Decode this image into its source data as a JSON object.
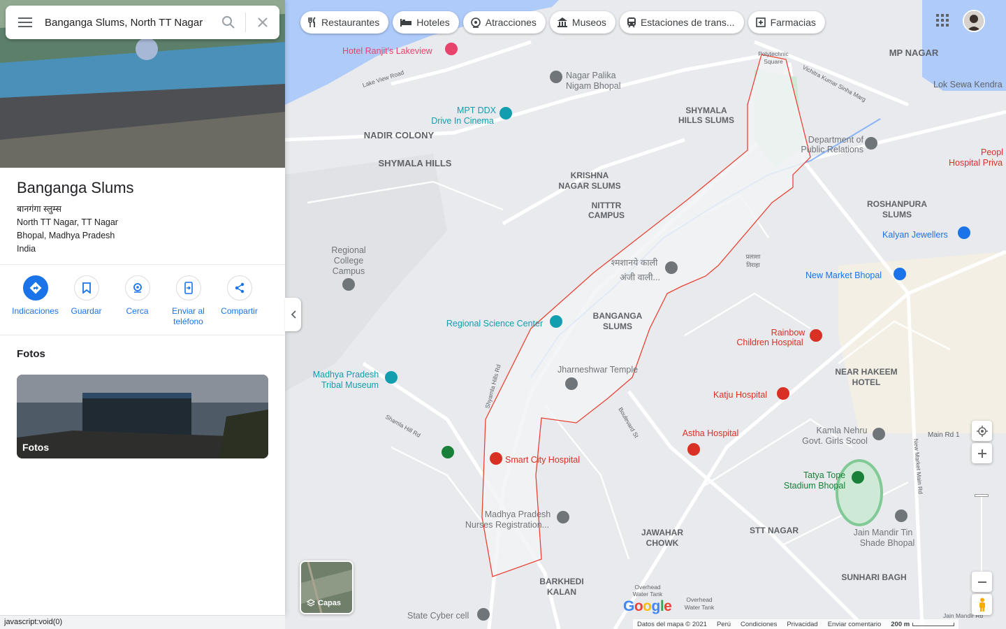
{
  "search": {
    "query": "Banganga Slums, North TT Nagar"
  },
  "place": {
    "name": "Banganga Slums",
    "name_local": "बानगंगा स्लुम्स",
    "address_lines": [
      "North TT Nagar, TT Nagar",
      "Bhopal, Madhya Pradesh",
      "India"
    ]
  },
  "actions": [
    {
      "label": "Indicaciones",
      "icon": "directions-icon"
    },
    {
      "label": "Guardar",
      "icon": "bookmark-icon"
    },
    {
      "label": "Cerca",
      "icon": "nearby-icon"
    },
    {
      "label": "Enviar al teléfono",
      "icon": "send-to-phone-icon"
    },
    {
      "label": "Compartir",
      "icon": "share-icon"
    }
  ],
  "photos": {
    "section_title": "Fotos",
    "tile_label": "Fotos"
  },
  "chips": [
    {
      "label": "Restaurantes",
      "icon": "fork-knife-icon"
    },
    {
      "label": "Hoteles",
      "icon": "bed-icon"
    },
    {
      "label": "Atracciones",
      "icon": "attraction-icon"
    },
    {
      "label": "Museos",
      "icon": "museum-icon"
    },
    {
      "label": "Estaciones de trans...",
      "icon": "transit-icon"
    },
    {
      "label": "Farmacias",
      "icon": "pharmacy-icon"
    }
  ],
  "layers": {
    "label": "Capas"
  },
  "footer": {
    "data": "Datos del mapa © 2021",
    "country": "Perú",
    "terms": "Condiciones",
    "privacy": "Privacidad",
    "feedback": "Enviar comentario",
    "scale": "200 m"
  },
  "status_bar": "javascript:void(0)",
  "map_labels": {
    "area": [
      "MP NAGAR",
      "SHYMALA HILLS SLUMS",
      "NADIR COLONY",
      "SHYMALA HILLS",
      "KRISHNA NAGAR SLUMS",
      "NITTTR CAMPUS",
      "ROSHANPURA SLUMS",
      "BANGANGA SLUMS",
      "NEAR HAKEEM HOTEL",
      "JAWAHAR CHOWK",
      "STT NAGAR",
      "SUNHARI BAGH",
      "BARKHEDI KALAN"
    ],
    "poi_gray": [
      "Nagar Palika Nigam Bhopal",
      "Department of Public Relations",
      "Regional College Campus",
      "Kamla Nehru Govt. Girls Scool",
      "Madhya Pradesh Nurses Registration...",
      "Jain Mandir Tin Shade Bhopal",
      "State Cyber cell",
      "श्मशानये काली अंजी वाली...",
      "Jharneshwar Temple"
    ],
    "poi_teal": [
      "MPT DDX Drive In Cinema",
      "Regional Science Center",
      "Madhya Pradesh Tribal Museum",
      "Tatya Tope Stadium Bhopal"
    ],
    "poi_red": [
      "Hotel Ranjit's Lakeview",
      "Rainbow Children Hospital",
      "Katju Hospital",
      "Astha Hospital",
      "Smart City Hospital",
      "Peoples Hospital Priva"
    ],
    "poi_blue": [
      "Kalyan Jewellers",
      "New Market Bhopal",
      "Lok Sewa Kendra"
    ],
    "roads": [
      "Lake View Road",
      "Vichitra Kumar Sinha Marg",
      "Shyamla Hills Rd",
      "Shamla Hill Rd",
      "Boulevard St",
      "New Market Main Rd",
      "Main Rd 1",
      "Polytechnic Square",
      "Jain Mandir Rd",
      "Overhead Water Tank",
      "प्रलाशा तिराहा"
    ]
  }
}
